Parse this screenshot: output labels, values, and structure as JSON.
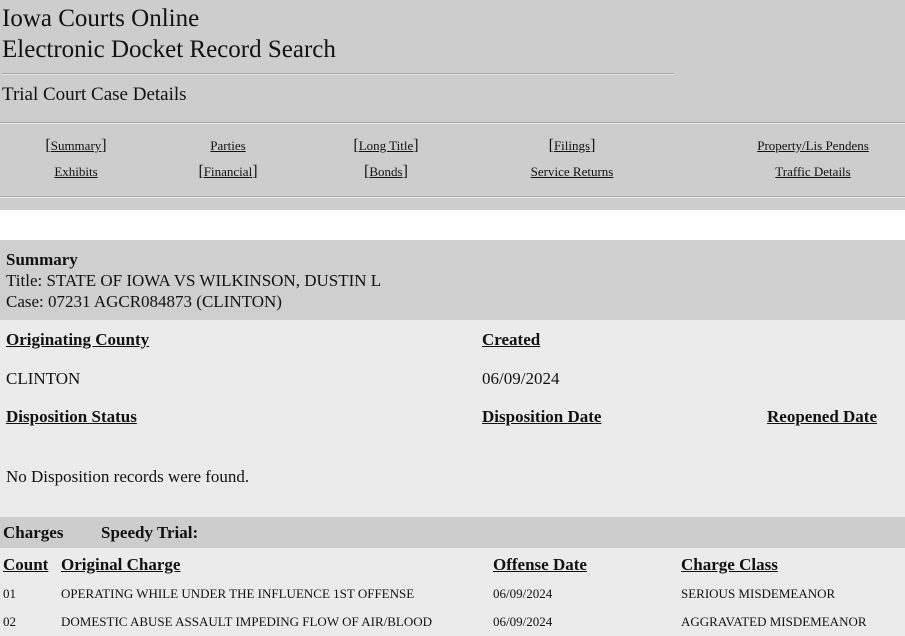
{
  "header": {
    "title_line1": "Iowa Courts Online",
    "title_line2": "Electronic Docket Record Search",
    "section_title": "Trial Court Case Details"
  },
  "nav": {
    "summary": "Summary",
    "parties": "Parties",
    "long_title": "Long Title",
    "filings": "Filings",
    "property": "Property/Lis Pendens",
    "exhibits": "Exhibits",
    "financial": "Financial",
    "bonds": "Bonds",
    "service_returns": "Service Returns",
    "traffic_details": "Traffic Details",
    "bracket_open": "[",
    "bracket_close": "]"
  },
  "summary": {
    "heading": "Summary",
    "title_line": "Title: STATE OF IOWA VS WILKINSON, DUSTIN L",
    "case_line": "Case: 07231 AGCR084873 (CLINTON)"
  },
  "details": {
    "originating_county_label": "Originating County",
    "originating_county_value": "CLINTON",
    "created_label": "Created",
    "created_value": "06/09/2024",
    "disposition_status_label": "Disposition Status",
    "disposition_date_label": "Disposition Date",
    "reopened_date_label": "Reopened Date",
    "no_records": "No Disposition records were found."
  },
  "charges": {
    "heading": "Charges",
    "speedy_trial_label": "Speedy Trial:",
    "columns": {
      "count": "Count",
      "original_charge": "Original Charge",
      "offense_date": "Offense Date",
      "charge_class": "Charge Class"
    },
    "rows": [
      {
        "count": "01",
        "charge": "OPERATING WHILE UNDER THE INFLUENCE 1ST OFFENSE",
        "offense_date": "06/09/2024",
        "charge_class": "SERIOUS MISDEMEANOR"
      },
      {
        "count": "02",
        "charge": "DOMESTIC ABUSE ASSAULT IMPEDING FLOW OF AIR/BLOOD",
        "offense_date": "06/09/2024",
        "charge_class": "AGGRAVATED MISDEMEANOR"
      }
    ]
  },
  "colors": {
    "header_bg": "#cdcdcd",
    "panel_bg": "#ebebeb"
  }
}
